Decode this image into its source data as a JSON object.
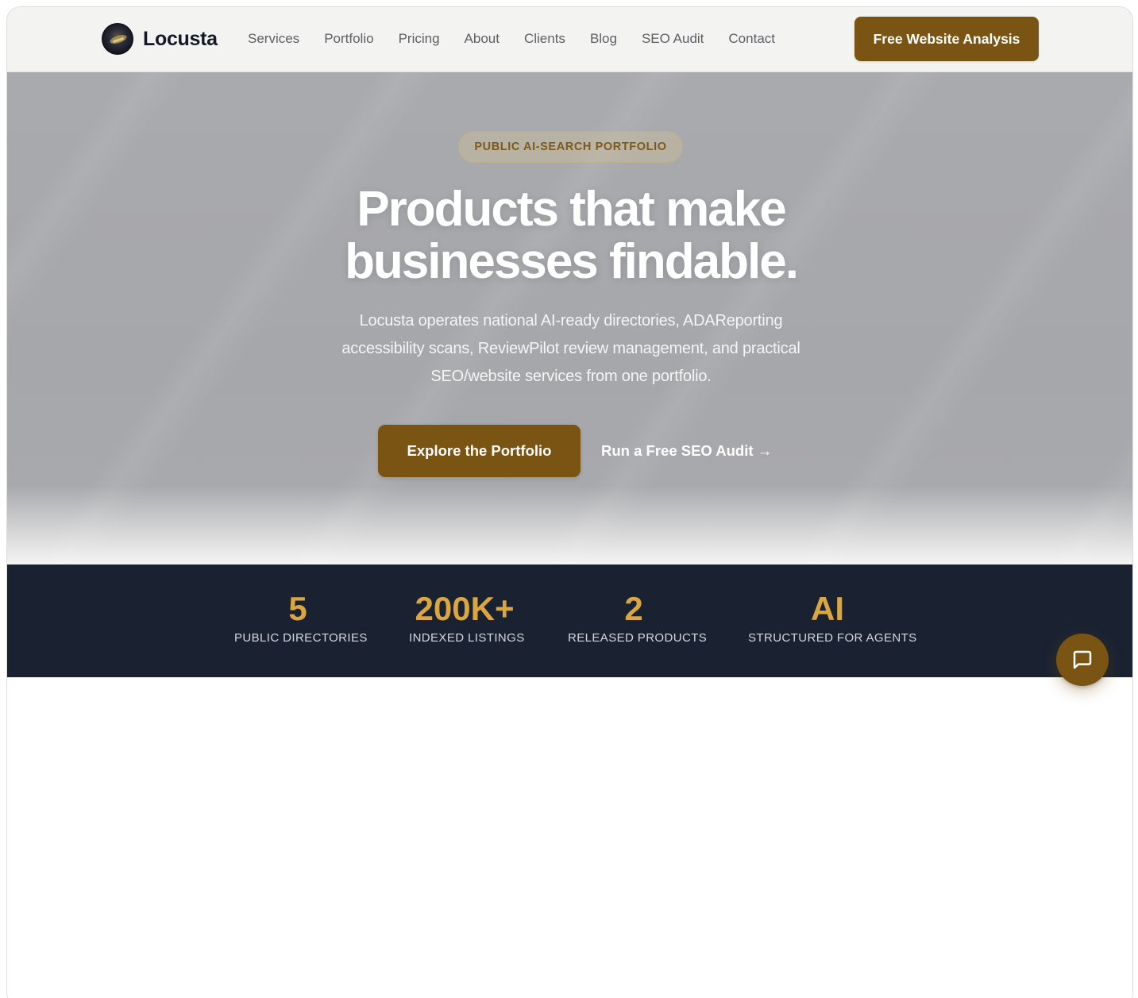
{
  "nav": {
    "brand": "Locusta",
    "links": [
      "Services",
      "Portfolio",
      "Pricing",
      "About",
      "Clients",
      "Blog",
      "SEO Audit",
      "Contact"
    ],
    "cta": "Free Website Analysis"
  },
  "hero": {
    "badge": "PUBLIC AI-SEARCH PORTFOLIO",
    "title_line1": "Products that make",
    "title_line2": "businesses findable.",
    "subtitle": "Locusta operates national AI-ready directories, ADAReporting accessibility scans, ReviewPilot review management, and practical SEO/website services from one portfolio.",
    "primary_button": "Explore the Portfolio",
    "secondary_link": "Run a Free SEO Audit →"
  },
  "stats": [
    {
      "value": "5",
      "label": "PUBLIC DIRECTORIES"
    },
    {
      "value": "200K+",
      "label": "INDEXED LISTINGS"
    },
    {
      "value": "2",
      "label": "RELEASED PRODUCTS"
    },
    {
      "value": "AI",
      "label": "STRUCTURED FOR AGENTS"
    }
  ],
  "colors": {
    "accent": "#7a5413",
    "stats_bg": "#1a2232",
    "stat_number": "#d9a640"
  },
  "icons": {
    "chat": "chat-bubble-icon",
    "logo": "locust-logo-icon"
  }
}
